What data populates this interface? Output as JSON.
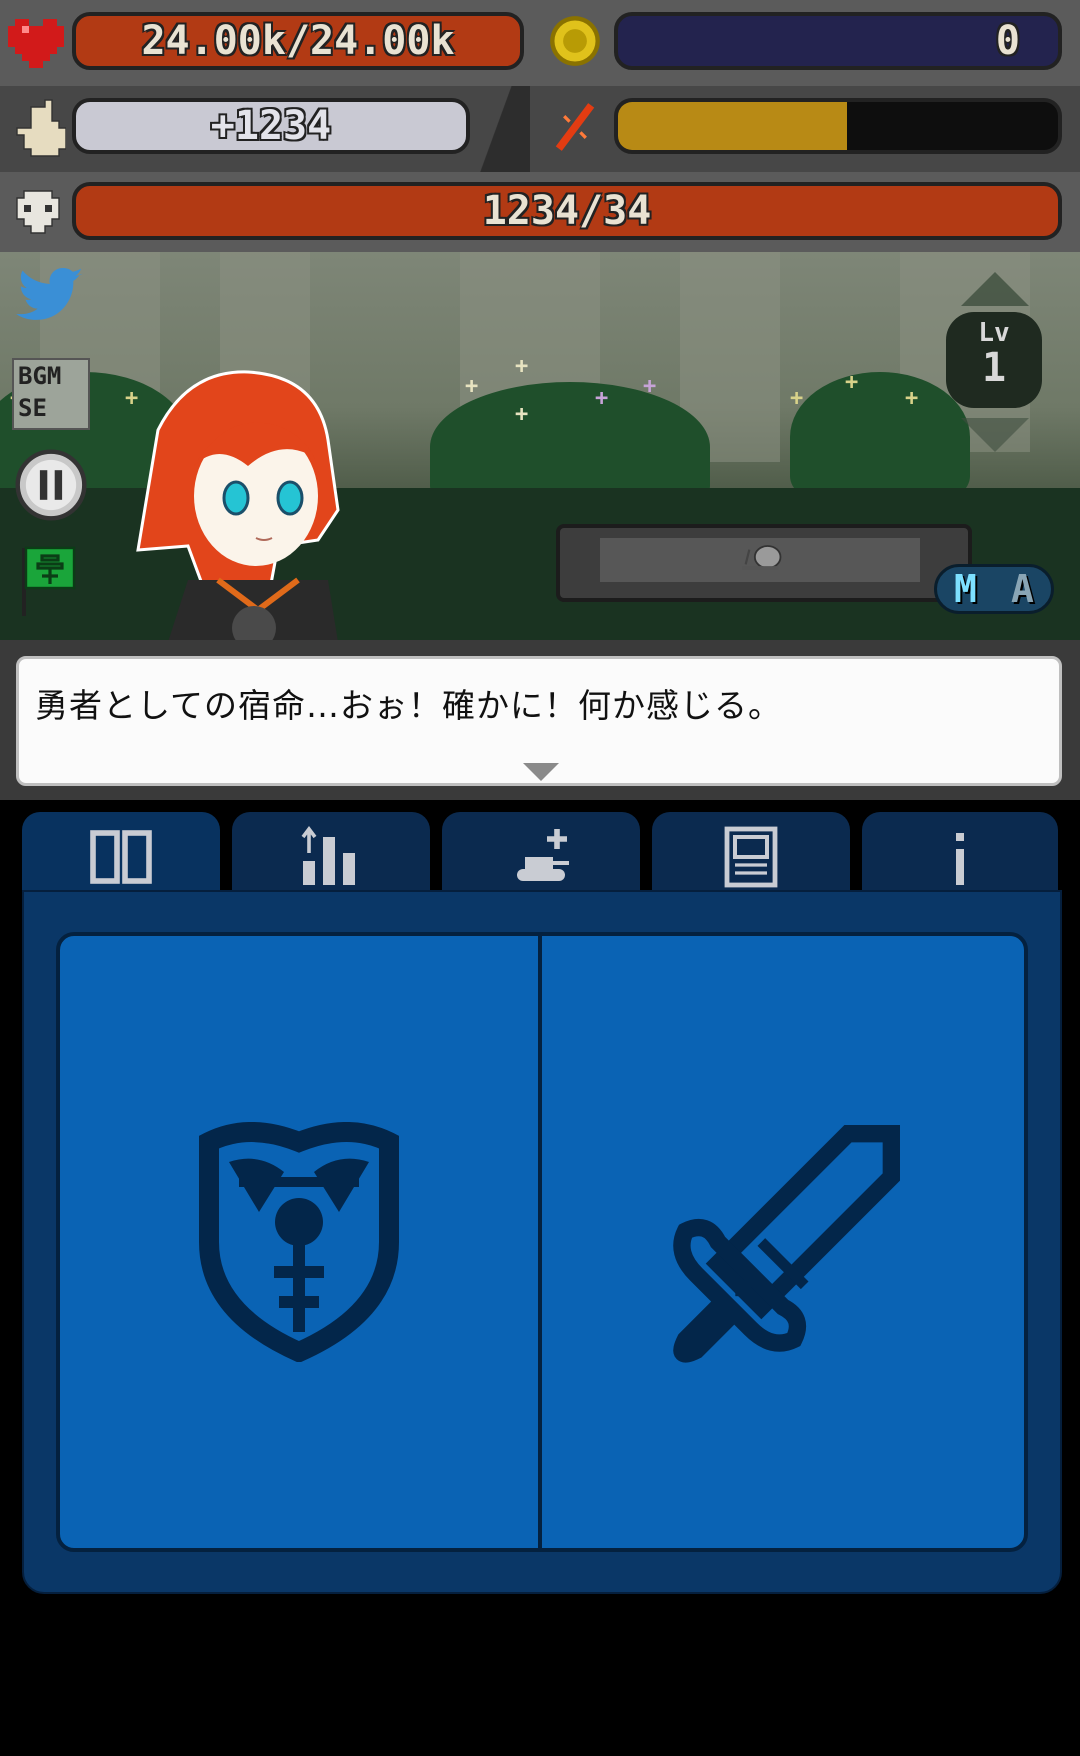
{
  "hud": {
    "hp_text": "24.00k/24.00k",
    "hp_fill_fraction": 1.0,
    "coins_text": "0",
    "tap_damage_text": "+1234",
    "special_fill_fraction": 0.52,
    "enemy_hp_text": "1234/34",
    "enemy_hp_fill_fraction": 1.0
  },
  "scene": {
    "bgm_label": "BGM",
    "se_label": "SE",
    "level_label": "Lv",
    "level_value": "1",
    "mode_m": "M",
    "mode_a": "A"
  },
  "dialog": {
    "text": "勇者としての宿命…おぉ！確かに！何か感じる。"
  },
  "tabs": [
    {
      "icon": "cards-icon",
      "active": true
    },
    {
      "icon": "upgrade-stats-icon",
      "active": false
    },
    {
      "icon": "tank-add-icon",
      "active": false
    },
    {
      "icon": "computer-icon",
      "active": false
    },
    {
      "icon": "info-icon",
      "active": false
    }
  ],
  "cards": [
    {
      "icon": "shield-icon"
    },
    {
      "icon": "sword-icon"
    }
  ],
  "colors": {
    "hp_bar": "#b23a14",
    "coin_bar": "#23234e",
    "tap_bar": "#c9c9d3",
    "special_bar": "#b88a15",
    "enemy_bar": "#b23a14",
    "panel_blue": "#0a63b4"
  }
}
